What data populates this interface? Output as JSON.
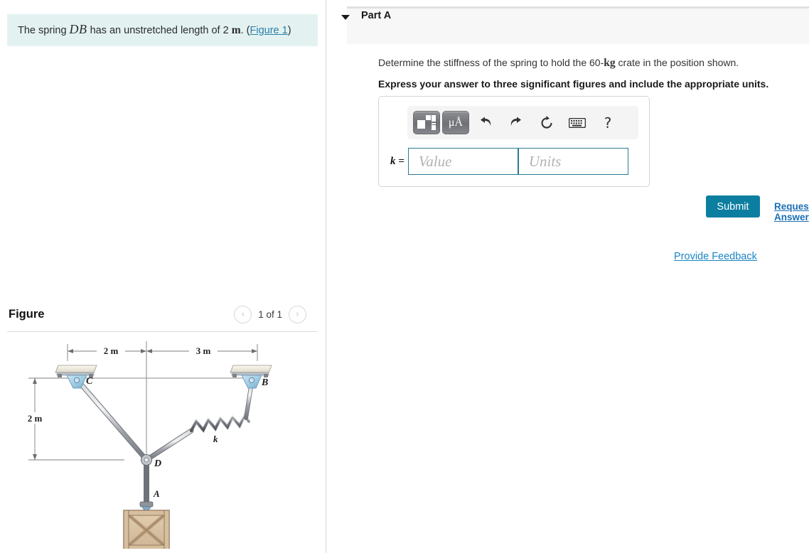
{
  "question": {
    "prefix": "The spring ",
    "italic_label": "DB",
    "middle": " has an unstretched length of 2 ",
    "unit": "m",
    "period": ". (",
    "figure_link": "Figure 1",
    "suffix": ")"
  },
  "figure": {
    "title": "Figure",
    "counter": "1 of 1",
    "prev_icon": "chevron-left-icon",
    "next_icon": "chevron-right-icon",
    "prev_glyph": "‹",
    "next_glyph": "›",
    "diagram": {
      "labels": {
        "C": "C",
        "B": "B",
        "D": "D",
        "A": "A",
        "k": "k"
      },
      "dimensions": {
        "left_span": "2 m",
        "right_span": "3 m",
        "vertical": "2 m"
      },
      "colors": {
        "support_body": "#9ec9e0",
        "support_plate": "#efeade",
        "rod": "#b9bcc0",
        "crate": "#d9c3a6",
        "dimension_line": "#777777"
      }
    }
  },
  "part": {
    "label": "Part A",
    "caret_icon": "caret-down-icon",
    "prompt_pre": "Determine the stiffness of the spring to hold the 60-",
    "prompt_unit": "kg",
    "prompt_post": " crate in the position shown.",
    "instruction": "Express your answer to three significant figures and include the appropriate units."
  },
  "answer": {
    "variable_label": "k =",
    "value_placeholder": "Value",
    "units_placeholder": "Units",
    "value_current": "",
    "units_current": "",
    "toolbar": [
      {
        "name": "template-icon",
        "glyph": ""
      },
      {
        "name": "micro-angstrom-units-icon",
        "glyph": "μÅ"
      },
      {
        "name": "undo-icon",
        "glyph": "↶"
      },
      {
        "name": "redo-icon",
        "glyph": "↷"
      },
      {
        "name": "reset-icon",
        "glyph": "↻"
      },
      {
        "name": "keyboard-icon",
        "glyph": "⌨"
      },
      {
        "name": "help-icon",
        "glyph": "?"
      }
    ]
  },
  "actions": {
    "submit": "Submit",
    "request_answer": "Request Answer",
    "provide_feedback": "Provide Feedback"
  },
  "colors": {
    "banner_bg": "#e3f2f1",
    "submit_bg": "#0c7ea0",
    "link": "#1b85c4",
    "input_border": "#2b7a95",
    "band_bg": "#f7f7f7"
  }
}
